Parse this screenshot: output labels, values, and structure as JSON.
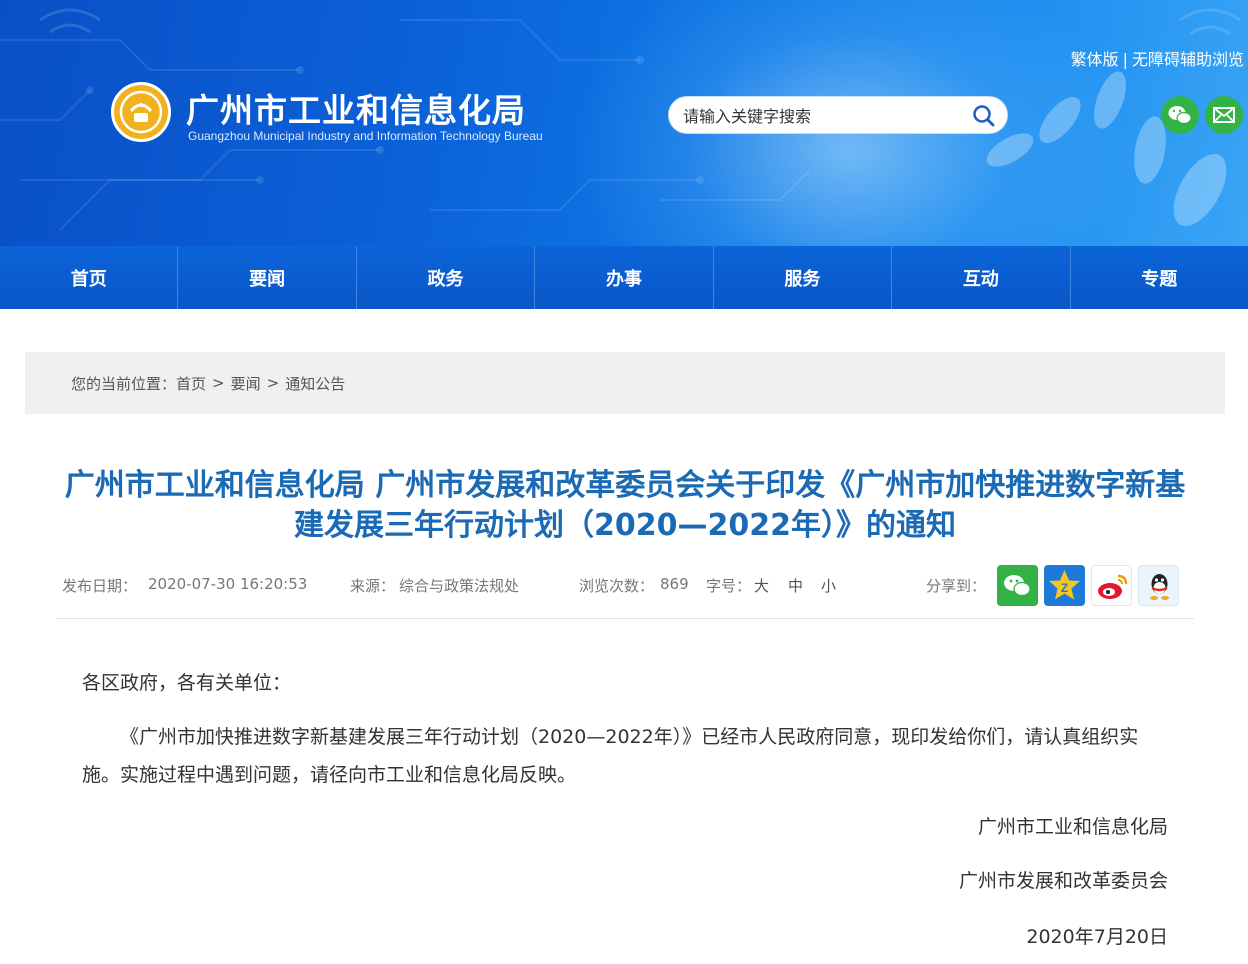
{
  "header": {
    "site_title": "广州市工业和信息化局",
    "site_subtitle": "Guangzhou Municipal Industry and Information Technology Bureau",
    "links": {
      "traditional": "繁体版",
      "separator": "|",
      "accessibility": "无障碍辅助浏览"
    },
    "search": {
      "placeholder": "请输入关键字搜索"
    },
    "icons": {
      "search": "search-icon",
      "wechat": "wechat-icon",
      "mail": "mail-icon"
    }
  },
  "nav": {
    "items": [
      {
        "label": "首页"
      },
      {
        "label": "要闻"
      },
      {
        "label": "政务"
      },
      {
        "label": "办事"
      },
      {
        "label": "服务"
      },
      {
        "label": "互动"
      },
      {
        "label": "专题"
      }
    ]
  },
  "breadcrumb": {
    "prefix": "您的当前位置：",
    "items": [
      "首页",
      "要闻",
      "通知公告"
    ],
    "separator": ">"
  },
  "article": {
    "title": "广州市工业和信息化局 广州市发展和改革委员会关于印发《广州市加快推进数字新基建发展三年行动计划（2020—2022年）》的通知",
    "meta": {
      "date_label": "发布日期：",
      "date": "2020-07-30 16:20:53",
      "source_label": "来源：",
      "source": "综合与政策法规处",
      "views_label": "浏览次数：",
      "views": "869",
      "font_label": "字号：",
      "font_large": "大",
      "font_medium": "中",
      "font_small": "小",
      "share_label": "分享到："
    },
    "share_icons": [
      "wechat-icon",
      "qzone-icon",
      "weibo-icon",
      "qq-icon"
    ],
    "salutation": "各区政府，各有关单位：",
    "body": "《广州市加快推进数字新基建发展三年行动计划（2020—2022年）》已经市人民政府同意，现印发给你们，请认真组织实施。实施过程中遇到问题，请径向市工业和信息化局反映。",
    "signature_1": "广州市工业和信息化局",
    "signature_2": "广州市发展和改革委员会",
    "signed_date": "2020年7月20日"
  },
  "colors": {
    "brand_blue": "#0a57c8",
    "title_blue": "#1a6ab5",
    "emblem_gold": "#f2b21f",
    "share_green": "#33b345"
  }
}
